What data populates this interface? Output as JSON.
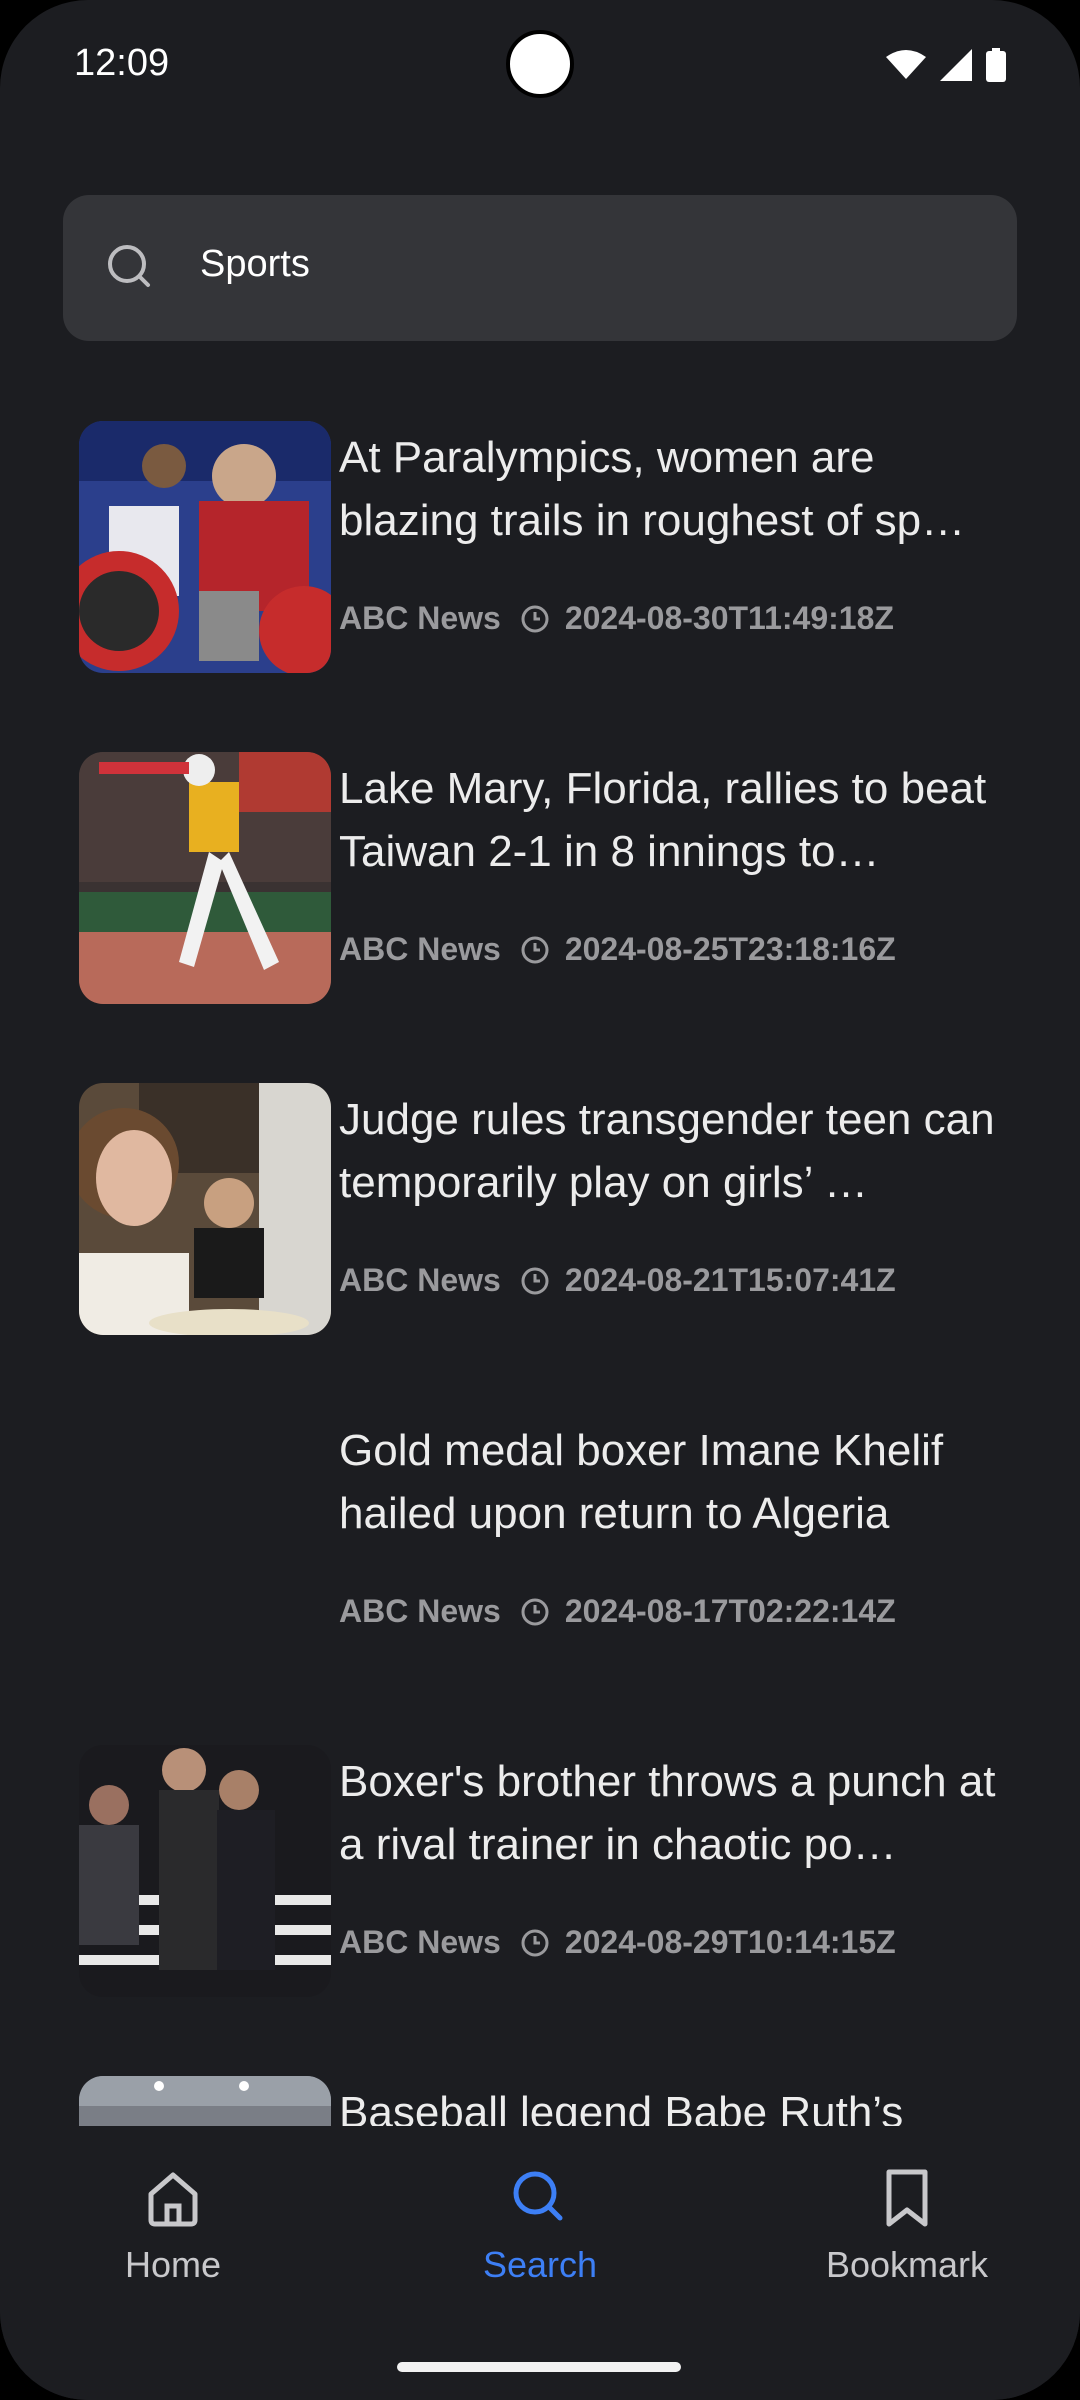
{
  "status_bar": {
    "time": "12:09",
    "icons": [
      "wifi-icon",
      "signal-icon",
      "battery-icon"
    ]
  },
  "search": {
    "query": "Sports",
    "icon": "search-icon"
  },
  "articles": [
    {
      "title": "At Paralympics, women are blazing trails in roughest of sp…",
      "source": "ABC News",
      "timestamp": "2024-08-30T11:49:18Z",
      "has_image": true
    },
    {
      "title": "Lake Mary, Florida, rallies to beat Taiwan 2-1 in 8 innings to…",
      "source": "ABC News",
      "timestamp": "2024-08-25T23:18:16Z",
      "has_image": true
    },
    {
      "title": "Judge rules transgender teen can temporarily play on girls’ …",
      "source": "ABC News",
      "timestamp": "2024-08-21T15:07:41Z",
      "has_image": true
    },
    {
      "title": "Gold medal boxer Imane Khelif hailed upon return to Algeria",
      "source": "ABC News",
      "timestamp": "2024-08-17T02:22:14Z",
      "has_image": false
    },
    {
      "title": "Boxer's brother throws a punch at a rival trainer in chaotic po…",
      "source": "ABC News",
      "timestamp": "2024-08-29T10:14:15Z",
      "has_image": true
    },
    {
      "title": "Baseball legend Babe Ruth’s",
      "source": "",
      "timestamp": "",
      "has_image": true
    }
  ],
  "bottom_nav": {
    "items": [
      {
        "label": "Home",
        "icon": "home-icon",
        "active": false
      },
      {
        "label": "Search",
        "icon": "search-icon",
        "active": true
      },
      {
        "label": "Bookmark",
        "icon": "bookmark-icon",
        "active": false
      }
    ]
  },
  "colors": {
    "background": "#1c1d21",
    "search_bar": "#343539",
    "accent": "#3d7ff5",
    "meta_text": "#9a9a9d"
  }
}
